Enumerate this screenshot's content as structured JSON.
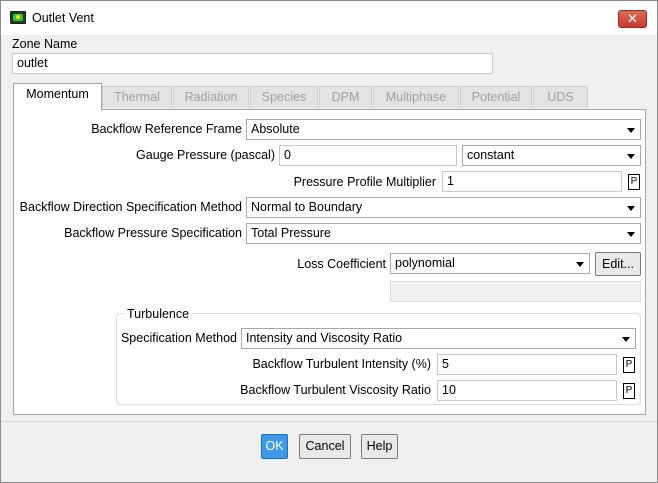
{
  "window": {
    "title": "Outlet Vent",
    "close_glyph": "✕"
  },
  "zone": {
    "label": "Zone Name",
    "value": "outlet"
  },
  "tabs": [
    {
      "label": "Momentum"
    },
    {
      "label": "Thermal"
    },
    {
      "label": "Radiation"
    },
    {
      "label": "Species"
    },
    {
      "label": "DPM"
    },
    {
      "label": "Multiphase"
    },
    {
      "label": "Potential"
    },
    {
      "label": "UDS"
    }
  ],
  "momentum": {
    "backflow_reference_frame": {
      "label": "Backflow Reference Frame",
      "value": "Absolute"
    },
    "gauge_pressure": {
      "label": "Gauge Pressure (pascal)",
      "value": "0",
      "method": "constant"
    },
    "pressure_profile_multiplier": {
      "label": "Pressure Profile Multiplier",
      "value": "1",
      "p_label": "P"
    },
    "backflow_direction": {
      "label": "Backflow Direction Specification Method",
      "value": "Normal to Boundary"
    },
    "backflow_pressure": {
      "label": "Backflow Pressure Specification",
      "value": "Total Pressure"
    },
    "loss_coefficient": {
      "label": "Loss Coefficient",
      "value": "polynomial",
      "edit_label": "Edit..."
    }
  },
  "turbulence": {
    "title": "Turbulence",
    "specification_method": {
      "label": "Specification Method",
      "value": "Intensity and Viscosity Ratio"
    },
    "intensity": {
      "label": "Backflow Turbulent Intensity (%)",
      "value": "5",
      "p_label": "P"
    },
    "viscosity_ratio": {
      "label": "Backflow Turbulent Viscosity Ratio",
      "value": "10",
      "p_label": "P"
    }
  },
  "buttons": {
    "ok": "OK",
    "cancel": "Cancel",
    "help": "Help"
  }
}
